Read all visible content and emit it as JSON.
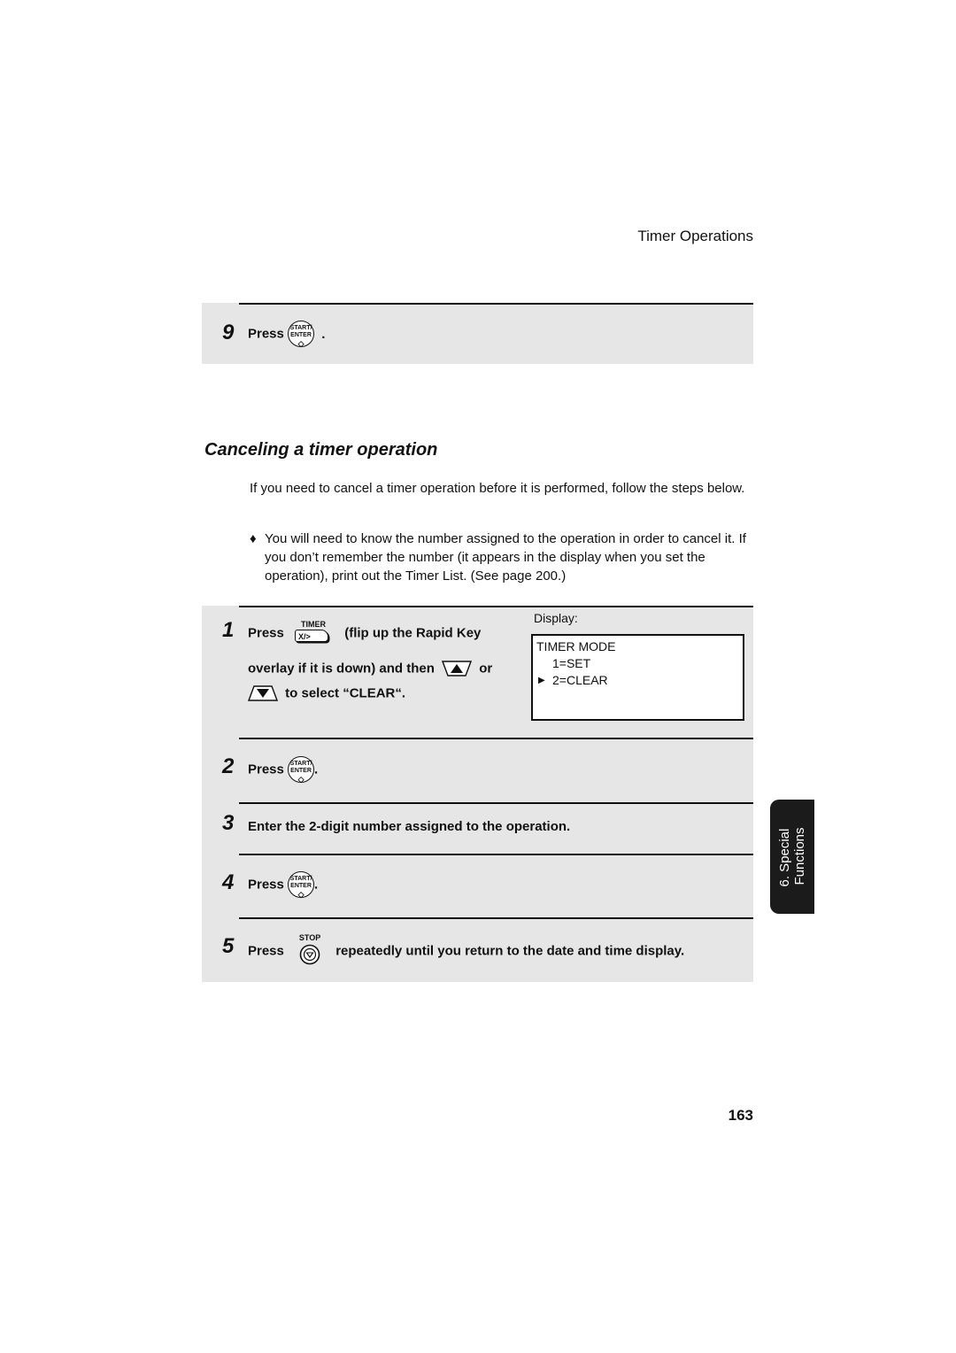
{
  "header": {
    "title": "Timer Operations"
  },
  "prev_step": {
    "number": "9",
    "press_label": "Press",
    "key": {
      "line1": "START/",
      "line2": "ENTER",
      "symbol": "◇"
    },
    "suffix": "."
  },
  "section": {
    "title": "Canceling a timer operation",
    "intro": "If you need to cancel a timer operation before it is performed, follow the steps below.",
    "bullet_symbol": "♦",
    "bullet": "You will need to know the number assigned to the operation in order to cancel it. If you don’t remember the number (it appears in the display when you set the operation), print out the Timer List. (See page 200.)"
  },
  "steps": [
    {
      "number": "1",
      "press_label": "Press",
      "key": {
        "label": "TIMER",
        "face": "X/>"
      },
      "text_a": "(flip up the Rapid Key",
      "text_b": "overlay if it is down) and then",
      "or_label": "or",
      "text_c": "to select “CLEAR“.",
      "display": {
        "label": "Display:",
        "lines": [
          "TIMER MODE",
          "1=SET",
          "2=CLEAR"
        ],
        "cursor_symbol": "▶"
      }
    },
    {
      "number": "2",
      "press_label": "Press",
      "key": {
        "line1": "START/",
        "line2": "ENTER",
        "symbol": "◇"
      },
      "suffix": "."
    },
    {
      "number": "3",
      "text": "Enter the 2-digit number assigned to the operation."
    },
    {
      "number": "4",
      "press_label": "Press",
      "key": {
        "line1": "START/",
        "line2": "ENTER",
        "symbol": "◇"
      },
      "suffix": "."
    },
    {
      "number": "5",
      "press_label": "Press",
      "key": {
        "label": "STOP"
      },
      "text": "repeatedly until you return to the date and time display."
    }
  ],
  "side_tab": {
    "line1": "6. Special",
    "line2": "Functions"
  },
  "page_number": "163"
}
